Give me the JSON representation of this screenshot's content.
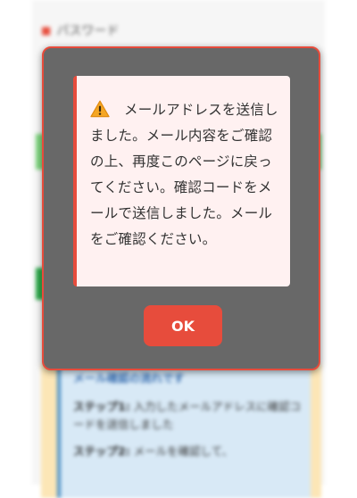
{
  "background": {
    "field_label": "パスワード",
    "info_box": {
      "title": "メール確認の流れです",
      "step1_label": "ステップ1:",
      "step1_text": " 入力したメールアドレスに確認コードを送信しました",
      "step2_label": "ステップ2:",
      "step2_text": " メールを確認して、"
    }
  },
  "dialog": {
    "icon": "warning-icon",
    "message": "メールアドレスを送信しました。メール内容をご確認の上、再度このページに戻ってください。確認コードをメールで送信しました。メールをご確認ください。",
    "ok_label": "OK"
  },
  "colors": {
    "accent": "#e74c3c",
    "overlay": "#686868",
    "message_bg": "#fff1f1",
    "warning": "#f5a623"
  }
}
